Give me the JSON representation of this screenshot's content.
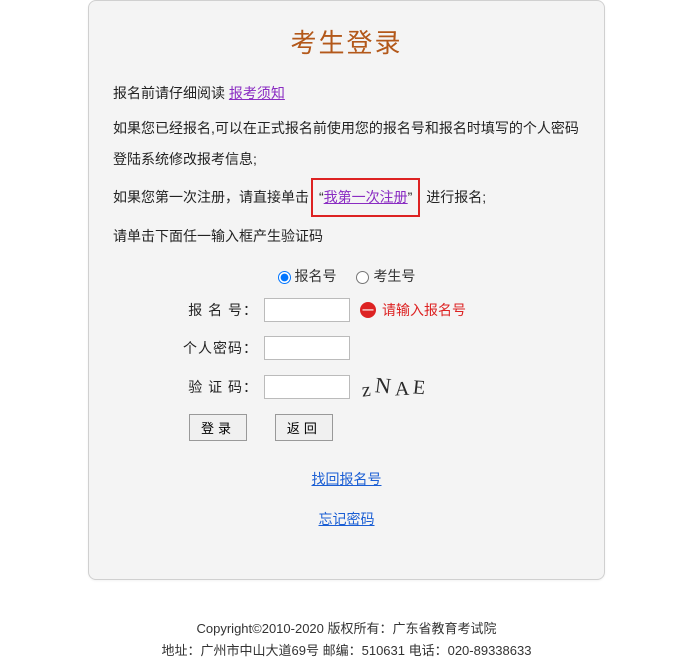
{
  "title": "考生登录",
  "instructions": {
    "line1_pre": "报名前请仔细阅读 ",
    "line1_link": "报考须知",
    "line2": "如果您已经报名,可以在正式报名前使用您的报名号和报名时填写的个人密码登陆系统修改报考信息;",
    "line3_pre": "如果您第一次注册，请直接单击",
    "line3_link_pre": "“",
    "line3_link": "我第一次注册",
    "line3_link_post": "”",
    "line3_post": " 进行报名;",
    "line4": "请单击下面任一输入框产生验证码"
  },
  "form": {
    "radio1": "报名号",
    "radio2": "考生号",
    "label_reg": "报 名 号：",
    "label_pwd": "个人密码：",
    "label_captcha": "验 证 码：",
    "error_msg": "请输入报名号",
    "captcha_chars": [
      "z",
      "N",
      "A",
      "E"
    ],
    "btn_login": "登录",
    "btn_back": "返回",
    "link_retrieve": "找回报名号",
    "link_forgot": "忘记密码"
  },
  "footer": {
    "line1": "Copyright©2010-2020 版权所有：广东省教育考试院",
    "line2": "地址：广州市中山大道69号 邮编：510631 电话：020-89338633"
  }
}
